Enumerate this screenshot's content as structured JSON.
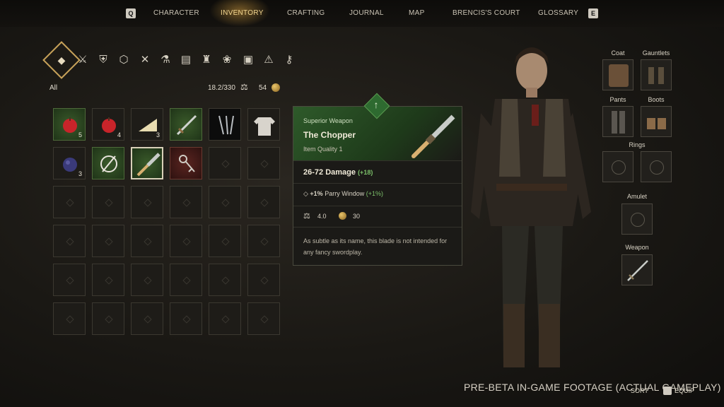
{
  "nav": {
    "key_left": "Q",
    "key_right": "E",
    "tabs": [
      "CHARACTER",
      "INVENTORY",
      "CRAFTING",
      "JOURNAL",
      "MAP",
      "BRENCIS'S COURT",
      "GLOSSARY"
    ],
    "active_tab": "INVENTORY"
  },
  "filter": {
    "label": "All",
    "categories": [
      "all-icon",
      "sword-icon",
      "armor-icon",
      "shield-icon",
      "tools-icon",
      "potion-icon",
      "book-icon",
      "shirt-icon",
      "herb-icon",
      "mug-icon",
      "alert-icon",
      "key-icon"
    ]
  },
  "stats": {
    "weight": "18.2/330",
    "gold": "54"
  },
  "inventory": [
    {
      "name": "apple-icon",
      "count": "5",
      "bg": "green"
    },
    {
      "name": "apple-icon",
      "count": "4",
      "bg": "dark"
    },
    {
      "name": "cheese-icon",
      "count": "3",
      "bg": "dark"
    },
    {
      "name": "sword-icon",
      "count": "",
      "bg": "green"
    },
    {
      "name": "nails-icon",
      "count": "",
      "bg": "black"
    },
    {
      "name": "shirt-icon",
      "count": "",
      "bg": "dark"
    },
    {
      "name": "plum-icon",
      "count": "3",
      "bg": "dark"
    },
    {
      "name": "empty-icon",
      "count": "",
      "bg": "green"
    },
    {
      "name": "chopper-icon",
      "count": "",
      "bg": "green",
      "selected": true
    },
    {
      "name": "key-icon",
      "count": "",
      "bg": "red"
    }
  ],
  "tooltip": {
    "type": "Superior Weapon",
    "name": "The Chopper",
    "quality": "Item Quality 1",
    "damage": "26-72 Damage",
    "damage_bonus": "(+18)",
    "perk_value": "+1%",
    "perk_label": "Parry Window",
    "perk_bonus": "(+1%)",
    "weight": "4.0",
    "price": "30",
    "description": "As subtle as its name, this blade is not intended for any fancy swordplay."
  },
  "equipment": {
    "coat": "Coat",
    "gauntlets": "Gauntlets",
    "pants": "Pants",
    "boots": "Boots",
    "rings": "Rings",
    "amulet": "Amulet",
    "weapon": "Weapon"
  },
  "footer": {
    "text": "PRE-BETA IN-GAME FOOTAGE (ACTUAL GAMEPLAY)",
    "sort": "SORT",
    "equip": "EQUIP"
  },
  "colors": {
    "accent": "#f2d690",
    "green": "#7cc06a",
    "selection": "#c9a35a"
  }
}
